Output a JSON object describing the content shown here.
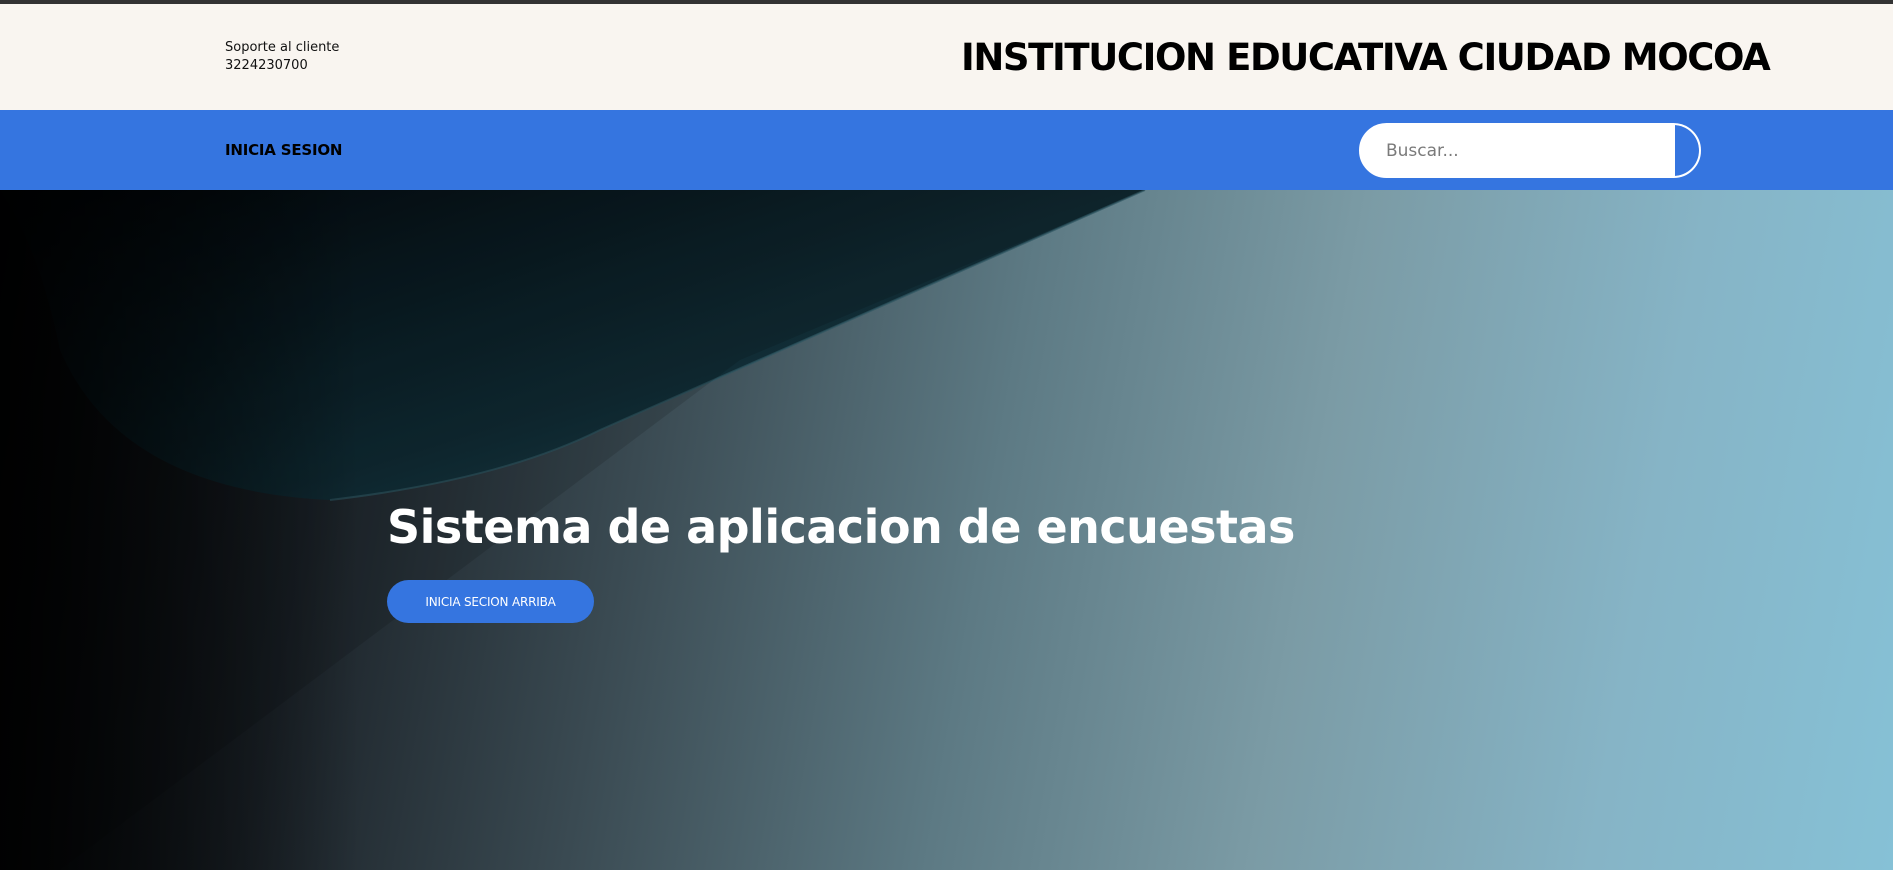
{
  "header": {
    "support_label": "Soporte al cliente",
    "support_phone": "3224230700",
    "brand_title": "INSTITUCION EDUCATIVA CIUDAD MOCOA"
  },
  "nav": {
    "login_label": "INICIA SESION",
    "search": {
      "placeholder": "Buscar...",
      "value": ""
    }
  },
  "hero": {
    "title": "Sistema de aplicacion de encuestas",
    "button_label": "INICIA SECION ARRIBA"
  },
  "colors": {
    "accent": "#3575e0",
    "header_bg": "#f9f5f0",
    "topline": "#333333"
  },
  "icons": {
    "search_button": "search-icon"
  }
}
